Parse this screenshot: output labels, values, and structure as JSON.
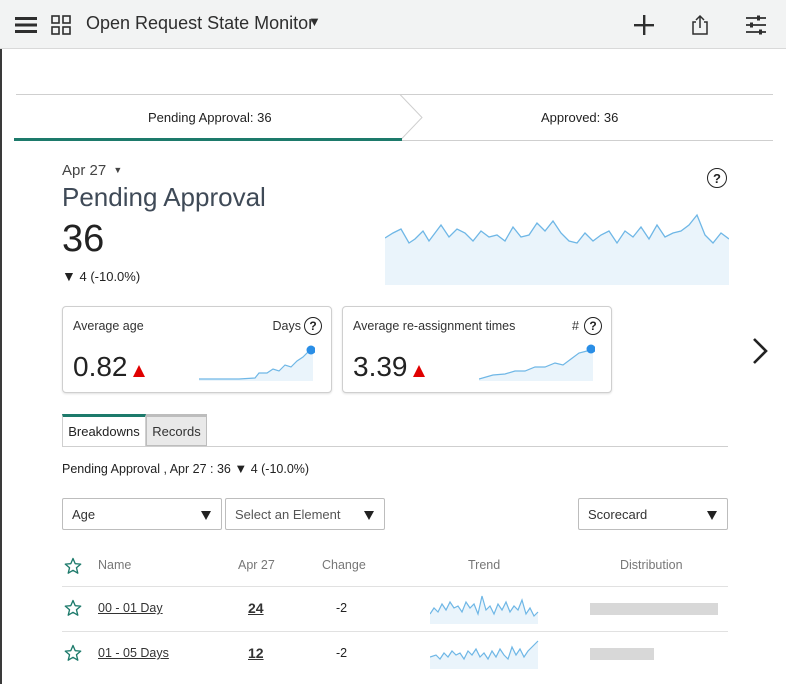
{
  "header": {
    "title": "Open Request State Monitor"
  },
  "stages": [
    {
      "label": "Pending Approval: 36"
    },
    {
      "label": "Approved: 36"
    }
  ],
  "indicator": {
    "date": "Apr 27",
    "title": "Pending Approval",
    "value": "36",
    "change": "4 (-10.0%)"
  },
  "cards": [
    {
      "title": "Average age",
      "unit": "Days",
      "value": "0.82"
    },
    {
      "title": "Average re-assignment times",
      "unit": "#",
      "value": "3.39"
    }
  ],
  "tabs": [
    {
      "label": "Breakdowns",
      "active": true
    },
    {
      "label": "Records",
      "active": false
    }
  ],
  "summary": {
    "prefix": "Pending Approval , Apr 27 : 36",
    "change": "4 (-10.0%)"
  },
  "filters": {
    "breakdown": "Age",
    "element": "Select an Element",
    "view": "Scorecard"
  },
  "table": {
    "columns": [
      "Name",
      "Apr 27",
      "Change",
      "Trend",
      "Distribution"
    ],
    "rows": [
      {
        "name": "00 - 01 Day",
        "value": "24",
        "change": "-2",
        "share": 1.0
      },
      {
        "name": "01 - 05 Days",
        "value": "12",
        "change": "-2",
        "share": 0.5
      }
    ]
  },
  "colors": {
    "accent": "#1d7a6b",
    "sparkline": "#6fb7e6",
    "down_alert": "#e00000"
  }
}
